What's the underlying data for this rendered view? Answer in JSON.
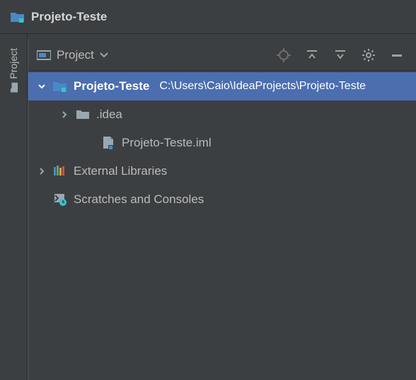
{
  "title": "Projeto-Teste",
  "rail": {
    "label": "Project"
  },
  "panel": {
    "title": "Project"
  },
  "tree": {
    "root": {
      "label": "Projeto-Teste",
      "path": "C:\\Users\\Caio\\IdeaProjects\\Projeto-Teste"
    },
    "idea": {
      "label": ".idea"
    },
    "iml": {
      "label": "Projeto-Teste.iml"
    },
    "external": {
      "label": "External Libraries"
    },
    "scratches": {
      "label": "Scratches and Consoles"
    }
  }
}
